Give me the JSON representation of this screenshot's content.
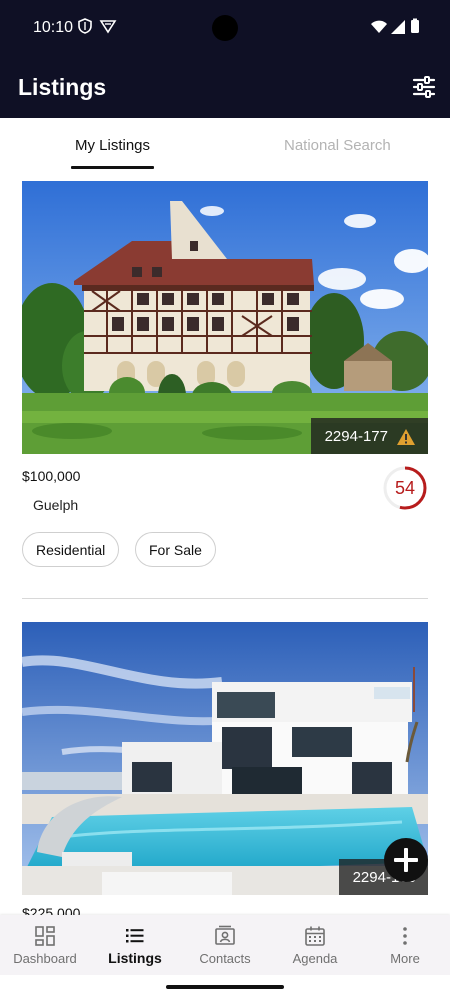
{
  "status_bar": {
    "time": "10:10"
  },
  "header": {
    "title": "Listings"
  },
  "tabs": [
    {
      "label": "My Listings",
      "active": true
    },
    {
      "label": "National Search",
      "active": false
    }
  ],
  "listings": [
    {
      "mls": "2294-177",
      "price": "$100,000",
      "city": "Guelph",
      "score": "54",
      "score_fraction": 0.54,
      "tags": [
        "Residential",
        "For Sale"
      ],
      "warning": true
    },
    {
      "mls": "2294-166",
      "price": "$225,000"
    }
  ],
  "bottom_nav": [
    {
      "label": "Dashboard",
      "icon": "dashboard-icon"
    },
    {
      "label": "Listings",
      "icon": "list-icon",
      "active": true
    },
    {
      "label": "Contacts",
      "icon": "contact-card-icon"
    },
    {
      "label": "Agenda",
      "icon": "calendar-icon"
    },
    {
      "label": "More",
      "icon": "more-vertical-icon"
    }
  ],
  "colors": {
    "header_bg": "#0f1025",
    "score_ring": "#b71c1c",
    "warning": "#e0a030"
  }
}
